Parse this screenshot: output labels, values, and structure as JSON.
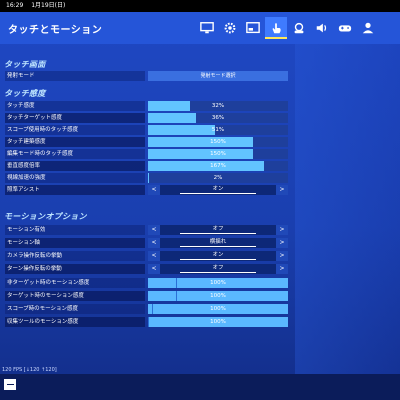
{
  "status_bar": {
    "time": "16:29",
    "date": "1月19日(日)"
  },
  "header": {
    "title": "タッチとモーション",
    "tabs": [
      {
        "icon": "monitor-icon"
      },
      {
        "icon": "gear-icon"
      },
      {
        "icon": "display-settings-icon"
      },
      {
        "icon": "touch-hand-icon",
        "active": true
      },
      {
        "icon": "game-device-icon"
      },
      {
        "icon": "speaker-icon"
      },
      {
        "icon": "gamepad-icon"
      },
      {
        "icon": "account-icon"
      }
    ]
  },
  "sections": {
    "touch_ui": "タッチ画面",
    "touch_sensitivity": "タッチ感度",
    "motion_options": "モーションオプション"
  },
  "touch_ui": {
    "fire_mode_label": "発射モード",
    "fire_mode_value": "発射モード選択"
  },
  "touch_sensitivity": [
    {
      "label": "タッチ感度",
      "value": "32%",
      "fill": 0.3
    },
    {
      "label": "タッチターゲット感度",
      "value": "36%",
      "fill": 0.34
    },
    {
      "label": "スコープ使用時のタッチ感度",
      "value": "51%",
      "fill": 0.48
    },
    {
      "label": "タッチ建築感度",
      "value": "150%",
      "fill": 0.75
    },
    {
      "label": "編集モード時のタッチ感度",
      "value": "150%",
      "fill": 0.75
    },
    {
      "label": "垂直感度倍率",
      "value": "167%",
      "fill": 0.83
    },
    {
      "label": "視線加速の強度",
      "value": "2%",
      "fill": 0.01
    }
  ],
  "aim_assist": {
    "label": "照準アシスト",
    "value": "オン"
  },
  "motion_options": [
    {
      "label": "モーション有効",
      "value": "オフ"
    },
    {
      "label": "モーション軸",
      "value": "横揺れ"
    },
    {
      "label": "カメラ操作反転の挙動",
      "value": "オン"
    },
    {
      "label": "ターン操作反転の挙動",
      "value": "オフ"
    }
  ],
  "motion_sensitivity": [
    {
      "label": "非ターゲット時のモーション感度",
      "value": "100%",
      "fill": 0.2
    },
    {
      "label": "ターゲット時のモーション感度",
      "value": "100%",
      "fill": 0.2
    },
    {
      "label": "スコープ時のモーション感度",
      "value": "100%",
      "fill": 0.03
    },
    {
      "label": "収集ツールのモーション感度",
      "value": "100%",
      "fill": 0.0
    }
  ],
  "arrows": {
    "left": "<",
    "right": ">"
  },
  "footer": {
    "fps": "120 FPS [↓120 ↑120]"
  },
  "colors": {
    "accent": "#3f7bff",
    "slider_fill": "#62c4ff",
    "background": "#1f48c4"
  }
}
